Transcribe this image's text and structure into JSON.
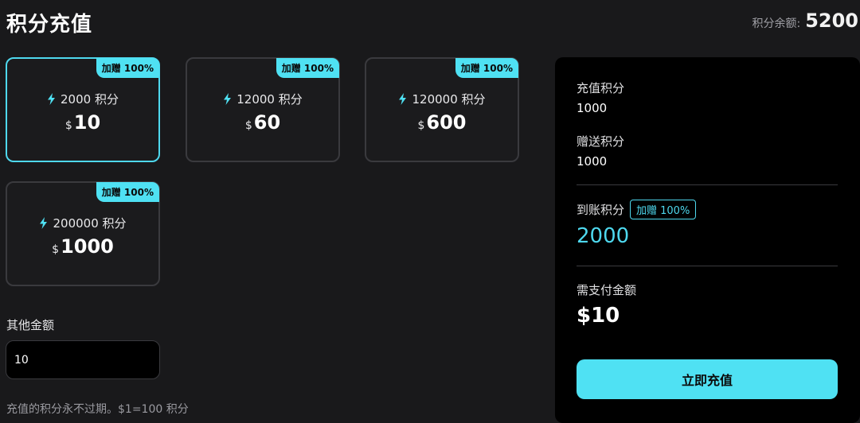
{
  "header": {
    "title": "积分充值",
    "balance_label": "积分余额:",
    "balance_value": "5200"
  },
  "packages": [
    {
      "badge": "加赠 100%",
      "points": "2000 积分",
      "currency": "$",
      "price": "10",
      "selected": true
    },
    {
      "badge": "加赠 100%",
      "points": "12000 积分",
      "currency": "$",
      "price": "60",
      "selected": false
    },
    {
      "badge": "加赠 100%",
      "points": "120000 积分",
      "currency": "$",
      "price": "600",
      "selected": false
    },
    {
      "badge": "加赠 100%",
      "points": "200000 积分",
      "currency": "$",
      "price": "1000",
      "selected": false
    }
  ],
  "other_amount": {
    "label": "其他金额",
    "value": "10"
  },
  "footnote": "充值的积分永不过期。$1=100 积分",
  "summary": {
    "recharge_label": "充值积分",
    "recharge_value": "1000",
    "bonus_label": "赠送积分",
    "bonus_value": "1000",
    "received_label": "到账积分",
    "received_badge": "加赠 100%",
    "received_value": "2000",
    "pay_label": "需支付金额",
    "pay_value": "$10",
    "button_label": "立即充值"
  },
  "colors": {
    "accent": "#4fe1f3",
    "background": "#19191b",
    "panel": "#000000"
  }
}
